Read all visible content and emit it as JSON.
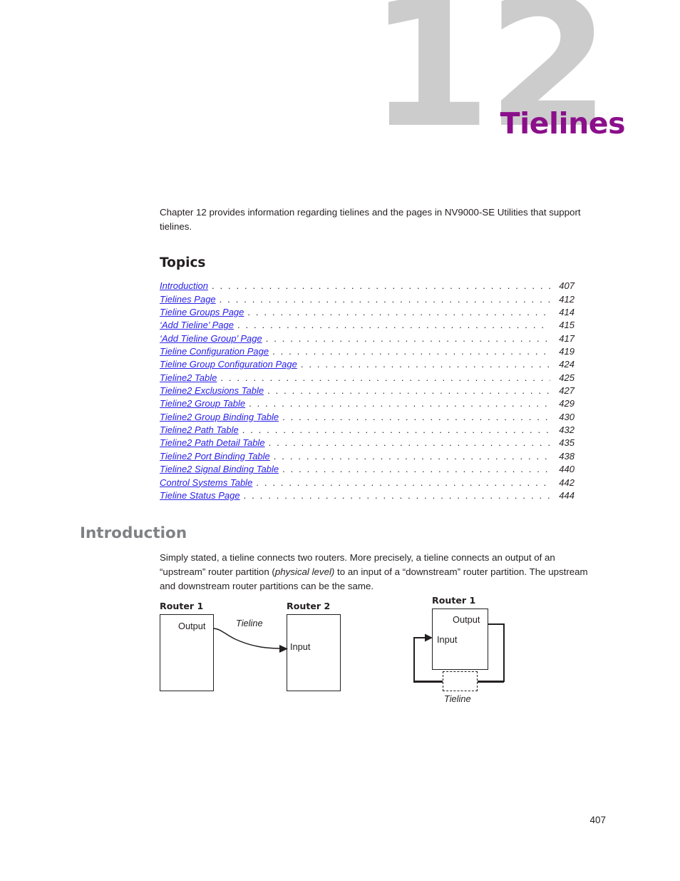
{
  "chapter": {
    "number": "12",
    "title": "Tielines",
    "blurb": "Chapter 12 provides information regarding tielines and the pages in NV9000-SE Utilities that support tielines."
  },
  "topics": {
    "heading": "Topics",
    "leader_dots": ". . . . . . . . . . . . . . . . . . . . . . . . . . . . . . . . . . . . . . . . . . . . . . . . . . . . . . . . . . . . . . . . . . . . . . . . . . . . . . . . . . . . . . . . . . . . . . . . . . . . . . . . . . . . .",
    "entries": [
      {
        "label": "Introduction",
        "page": "407"
      },
      {
        "label": "Tielines Page",
        "page": "412"
      },
      {
        "label": "Tieline Groups Page",
        "page": "414"
      },
      {
        "label": "‘Add Tieline’ Page",
        "page": "415"
      },
      {
        "label": "‘Add Tieline Group’ Page",
        "page": "417"
      },
      {
        "label": "Tieline Configuration Page",
        "page": "419"
      },
      {
        "label": "Tieline Group Configuration Page",
        "page": "424"
      },
      {
        "label": "Tieline2 Table",
        "page": "425"
      },
      {
        "label": "Tieline2 Exclusions Table",
        "page": "427"
      },
      {
        "label": "Tieline2 Group Table",
        "page": "429"
      },
      {
        "label": "Tieline2 Group Binding Table",
        "page": "430"
      },
      {
        "label": "Tieline2 Path Table",
        "page": "432"
      },
      {
        "label": "Tieline2 Path Detail Table",
        "page": "435"
      },
      {
        "label": "Tieline2 Port Binding Table",
        "page": "438"
      },
      {
        "label": "Tieline2 Signal Binding Table",
        "page": "440"
      },
      {
        "label": "Control Systems Table",
        "page": "442"
      },
      {
        "label": "Tieline Status Page",
        "page": "444"
      }
    ]
  },
  "introduction": {
    "heading": "Introduction",
    "paragraph_part1": "Simply stated, a tieline connects two routers. More precisely, a tieline connects an output of an “upstream” router partition (",
    "paragraph_emphasis": "physical level)",
    "paragraph_part2": " to an input of a “downstream” router partition. The upstream and downstream router partitions can be the same."
  },
  "figure_left": {
    "router1_label": "Router 1",
    "router2_label": "Router 2",
    "output_label": "Output",
    "input_label": "Input",
    "tieline_label": "Tieline"
  },
  "figure_right": {
    "router1_label": "Router 1",
    "output_label": "Output",
    "input_label": "Input",
    "tieline_label": "Tieline"
  },
  "footer": {
    "page_number": "407"
  },
  "colors": {
    "chapter_number": "#cccccc",
    "chapter_title": "#8b0f8b",
    "link": "#2a21e8",
    "section_heading": "#808184",
    "body_text": "#231f20"
  }
}
